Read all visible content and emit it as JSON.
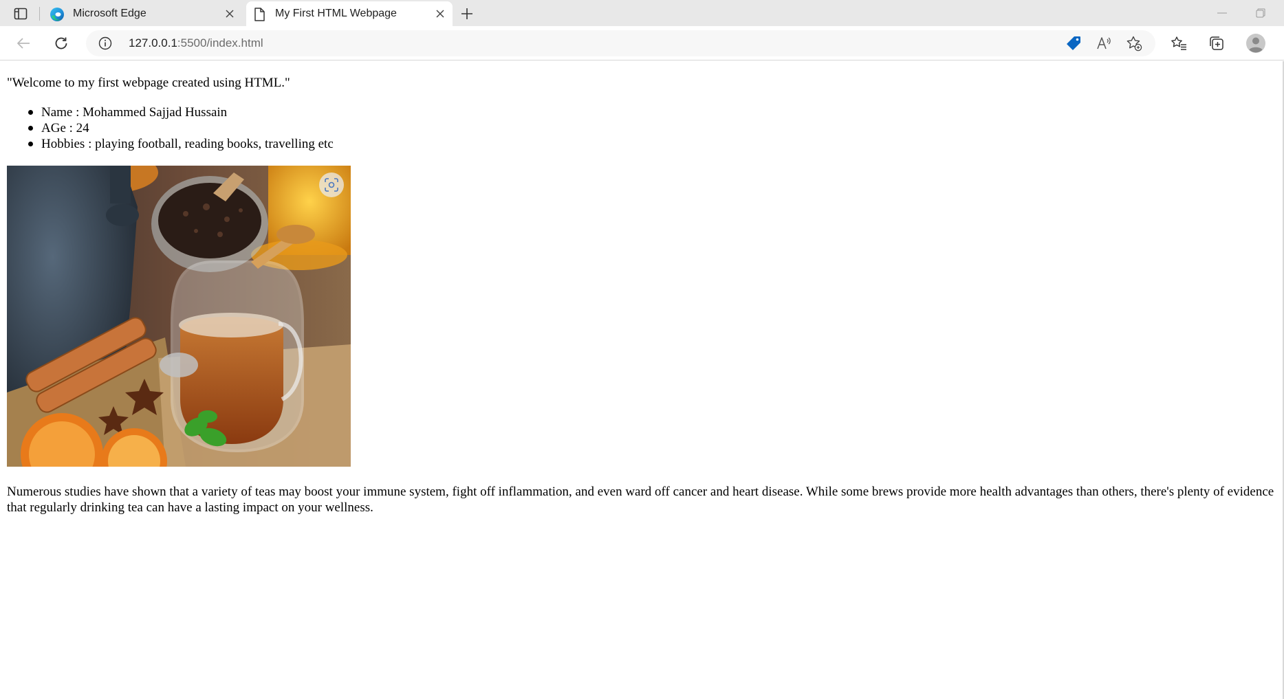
{
  "browser": {
    "tabs": [
      {
        "title": "Microsoft Edge",
        "icon": "edge-logo-icon",
        "active": false
      },
      {
        "title": "My First HTML Webpage",
        "icon": "page-icon",
        "active": true
      }
    ],
    "address_bar": {
      "host": "127.0.0.1",
      "path": ":5500/index.html"
    }
  },
  "page": {
    "intro": "\"Welcome to my first webpage created using HTML.\"",
    "list": [
      "Name : Mohammed Sajjad Hussain",
      "AGe : 24",
      "Hobbies : playing football, reading books, travelling etc"
    ],
    "paragraph": "Numerous studies have shown that a variety of teas may boost your immune system, fight off inflammation, and even ward off cancer and heart disease. While some brews provide more health advantages than others, there's plenty of evidence that regularly drinking tea can have a lasting impact on your wellness."
  },
  "colors": {
    "tab_strip": "#e8e8e8",
    "accent": "#0a66c2",
    "url_path": "#6b6b6b"
  }
}
